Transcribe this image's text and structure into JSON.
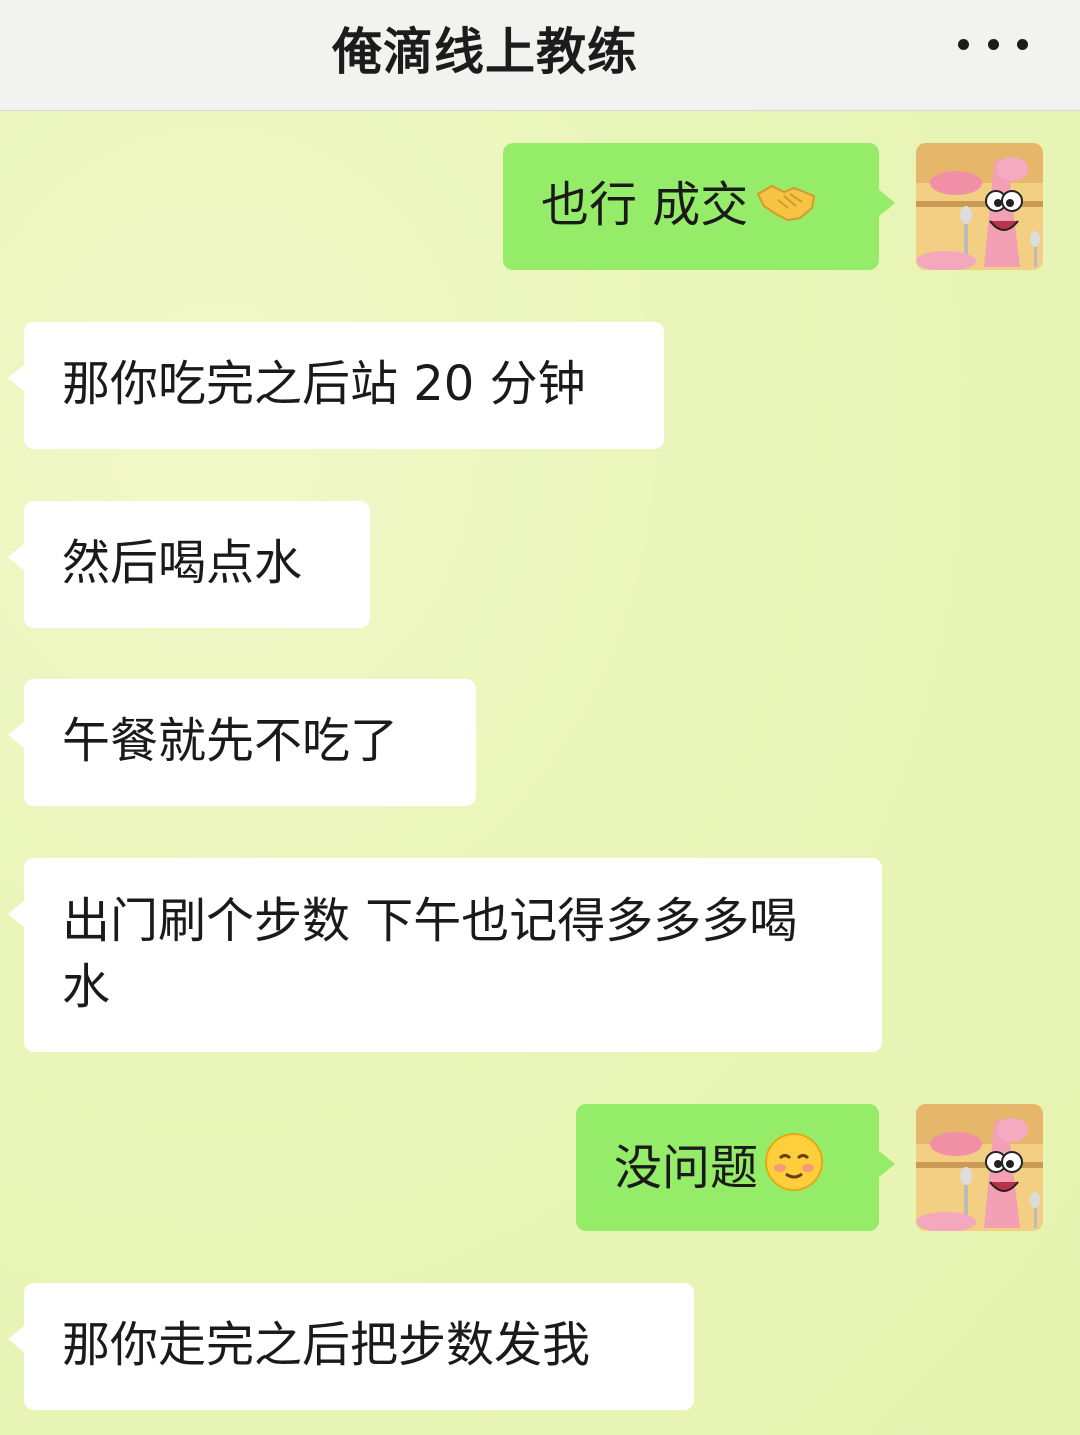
{
  "header": {
    "title": "俺滴线上教练",
    "more_icon": "more-dots-icon"
  },
  "messages": [
    {
      "side": "out",
      "text": "也行 成交",
      "emoji": "handshake"
    },
    {
      "side": "in",
      "text": "那你吃完之后站 20 分钟"
    },
    {
      "side": "in",
      "text": "然后喝点水"
    },
    {
      "side": "in",
      "text": "午餐就先不吃了"
    },
    {
      "side": "in",
      "text": "出门刷个步数  下午也记得多多多喝水"
    },
    {
      "side": "out",
      "text": "没问题",
      "emoji": "smiling-face"
    },
    {
      "side": "in",
      "text": "那你走完之后把步数发我"
    }
  ],
  "colors": {
    "background": "#e8f4b6",
    "incoming_bubble": "#ffffff",
    "outgoing_bubble": "#95ec69",
    "header_bg": "#f2f2f0"
  },
  "avatar": {
    "icon": "patrick-star-avatar-icon"
  }
}
